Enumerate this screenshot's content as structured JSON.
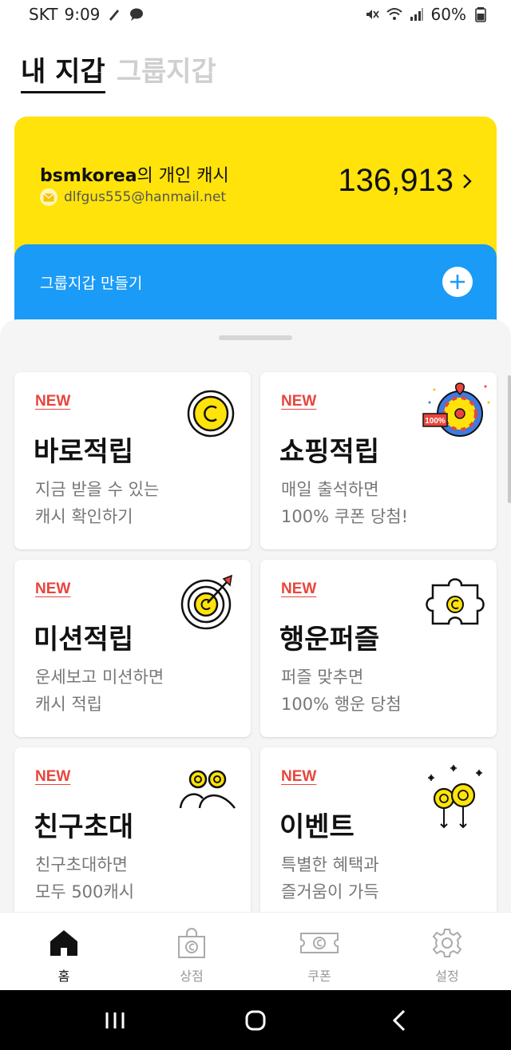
{
  "status_bar": {
    "carrier": "SKT",
    "time": "9:09",
    "battery": "60%"
  },
  "tabs": {
    "my_wallet": "내 지갑",
    "group_wallet": "그룹지갑"
  },
  "wallet": {
    "owner": "bsmkorea",
    "owner_suffix": "의 개인 캐시",
    "email": "dlfgus555@hanmail.net",
    "amount": "136,913",
    "accent": "#ffe30a"
  },
  "group": {
    "label": "그룹지갑 만들기",
    "accent": "#1a9bf7"
  },
  "cards": [
    {
      "badge": "NEW",
      "title": "바로적립",
      "desc": "지금 받을 수 있는\n캐시 확인하기",
      "icon": "coin-icon"
    },
    {
      "badge": "NEW",
      "title": "쇼핑적립",
      "desc": "매일 출석하면\n100% 쿠폰 당첨!",
      "icon": "roulette-icon",
      "icon_text": "100%"
    },
    {
      "badge": "NEW",
      "title": "미션적립",
      "desc": "운세보고 미션하면\n캐시 적립",
      "icon": "target-icon"
    },
    {
      "badge": "NEW",
      "title": "행운퍼즐",
      "desc": "퍼즐 맞추면\n100% 행운 당첨",
      "icon": "puzzle-icon"
    },
    {
      "badge": "NEW",
      "title": "친구초대",
      "desc": "친구초대하면\n모두 500캐시",
      "icon": "friends-icon"
    },
    {
      "badge": "NEW",
      "title": "이벤트",
      "desc": "특별한 혜택과\n즐거움이 가득",
      "icon": "balloons-icon"
    }
  ],
  "nav": {
    "home": "홈",
    "store": "상점",
    "coupon": "쿠폰",
    "settings": "설정"
  },
  "colors": {
    "new_badge": "#e8453c",
    "coin_yellow": "#ffe30a"
  }
}
